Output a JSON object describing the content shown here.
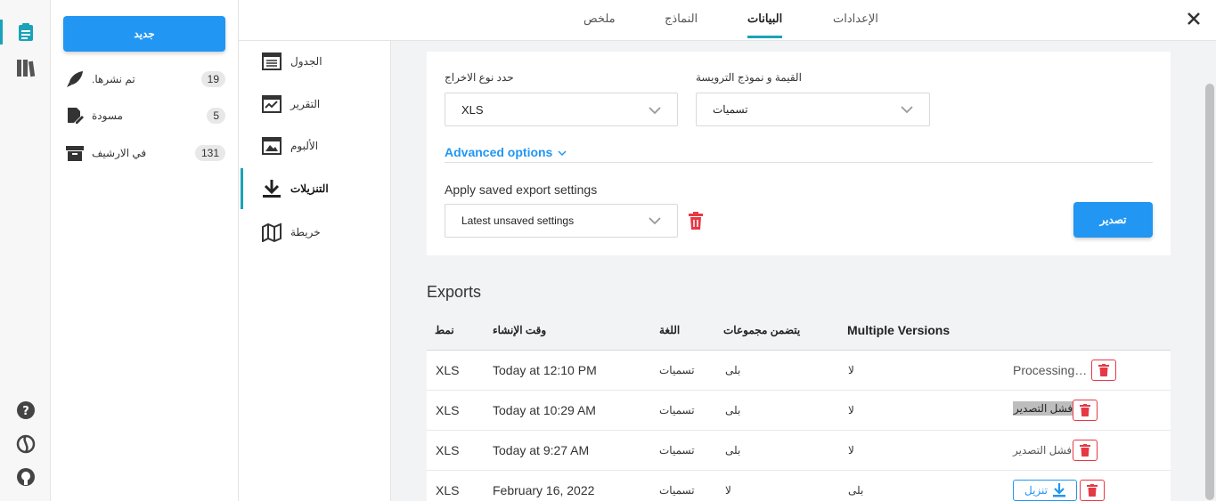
{
  "colors": {
    "accent": "#1aa3b8",
    "primary": "#2196f3",
    "danger": "#e53945"
  },
  "rail": {
    "top_icons": [
      "clipboard-icon",
      "library-icon"
    ],
    "bottom_icons": [
      "help-icon",
      "globe-icon",
      "github-icon"
    ]
  },
  "projects": {
    "new_label": "جديد",
    "items": [
      {
        "label": ".تم نشرها",
        "count": "19",
        "icon": "rocket-icon"
      },
      {
        "label": "مسودة",
        "count": "5",
        "icon": "draft-icon"
      },
      {
        "label": "في الارشيف",
        "count": "131",
        "icon": "archive-icon"
      }
    ]
  },
  "header": {
    "tabs": [
      {
        "label": "ملخص"
      },
      {
        "label": "النماذج"
      },
      {
        "label": "البيانات",
        "active": true
      },
      {
        "label": "الإعدادات"
      }
    ]
  },
  "sections": [
    {
      "label": "الجدول",
      "icon": "table-icon"
    },
    {
      "label": "التقرير",
      "icon": "report-icon"
    },
    {
      "label": "الألبوم",
      "icon": "album-icon"
    },
    {
      "label": "التنزيلات",
      "icon": "download-icon",
      "active": true
    },
    {
      "label": "خريطة",
      "icon": "map-icon"
    }
  ],
  "export_form": {
    "type_label": "حدد نوع الاخراج",
    "type_value": "XLS",
    "header_label": "القيمة و نموذج الترويسة",
    "header_value": "تسميات",
    "advanced_label": "Advanced options",
    "apply_label": "Apply saved export settings",
    "apply_value": "Latest unsaved settings",
    "export_button": "تصدير"
  },
  "exports": {
    "title": "Exports",
    "columns": {
      "type": "نمط",
      "created": "وقت الإنشاء",
      "language": "اللغة",
      "groups": "يتضمن مجموعات",
      "multi": "Multiple Versions"
    },
    "rows": [
      {
        "type": "XLS",
        "created": "Today at 12:10 PM",
        "language": "تسميات",
        "groups": "بلى",
        "multi": "لا",
        "status": "Processing…"
      },
      {
        "type": "XLS",
        "created": "Today at 10:29 AM",
        "language": "تسميات",
        "groups": "بلى",
        "multi": "لا",
        "status": "فشل التصدير"
      },
      {
        "type": "XLS",
        "created": "Today at 9:27 AM",
        "language": "تسميات",
        "groups": "بلى",
        "multi": "لا",
        "status": "فشل التصدير"
      },
      {
        "type": "XLS",
        "created": "February 16, 2022",
        "language": "تسميات",
        "groups": "لا",
        "multi": "بلى",
        "download": "تنزيل"
      }
    ]
  }
}
